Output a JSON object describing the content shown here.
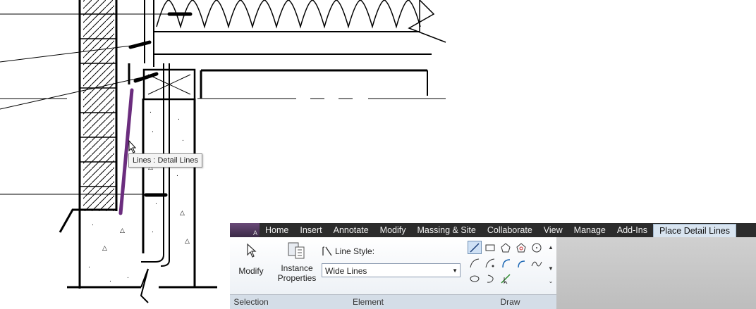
{
  "canvas": {
    "tooltip": "Lines : Detail Lines",
    "detail_line_color": "#6b2d7e"
  },
  "ribbon": {
    "app_letter": "A",
    "tabs": [
      {
        "label": "Home"
      },
      {
        "label": "Insert"
      },
      {
        "label": "Annotate"
      },
      {
        "label": "Modify"
      },
      {
        "label": "Massing & Site"
      },
      {
        "label": "Collaborate"
      },
      {
        "label": "View"
      },
      {
        "label": "Manage"
      },
      {
        "label": "Add-Ins"
      },
      {
        "label": "Place Detail Lines",
        "active": true
      }
    ],
    "panels": {
      "selection": {
        "title": "Selection",
        "modify_label": "Modify"
      },
      "element": {
        "title": "Element",
        "instance_properties_line1": "Instance",
        "instance_properties_line2": "Properties",
        "line_style_label": "Line Style:",
        "line_style_value": "Wide Lines"
      },
      "draw": {
        "title": "Draw",
        "tools": [
          "line-icon",
          "rectangle-icon",
          "inscribed-polygon-icon",
          "circumscribed-polygon-icon",
          "circle-icon",
          "start-end-radius-arc-icon",
          "center-ends-arc-icon",
          "tangent-end-arc-icon",
          "fillet-arc-icon",
          "spline-icon",
          "ellipse-icon",
          "partial-ellipse-icon",
          "pick-lines-icon"
        ]
      }
    },
    "accent": "#d8e4f0"
  }
}
